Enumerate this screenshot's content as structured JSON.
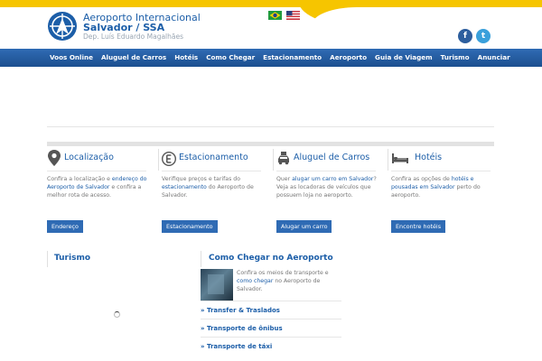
{
  "header": {
    "title_line1": "Aeroporto Internacional",
    "title_line2": "Salvador / SSA",
    "subtitle": "Dep. Luís Eduardo Magalhães",
    "colors": {
      "brand": "#1c5ea8",
      "accent": "#f6c500"
    }
  },
  "social": {
    "facebook": "f",
    "twitter": "t"
  },
  "nav": {
    "items": [
      "Voos Online",
      "Aluguel de Carros",
      "Hotéis",
      "Como Chegar",
      "Estacionamento",
      "Aeroporto",
      "Guia de Viagem",
      "Turismo",
      "Anunciar"
    ]
  },
  "cards": [
    {
      "icon": "map-pin-icon",
      "title": "Localização",
      "text_a": "Confira a localização e ",
      "link": "endereço do Aeroporto de Salvador",
      "text_b": " e confira a melhor rota de acesso.",
      "button": "Endereço"
    },
    {
      "icon": "parking-icon",
      "title": "Estacionamento",
      "text_a": "Verifique preços e tarifas do ",
      "link": "estacionamento",
      "text_b": " do Aeroporto de Salvador.",
      "button": "Estacionamento"
    },
    {
      "icon": "car-icon",
      "title": "Aluguel de Carros",
      "text_a": "Quer ",
      "link": "alugar um carro em Salvador",
      "text_b": "? Veja as locadoras de veículos que possuem loja no aeroporto.",
      "button": "Alugar um carro"
    },
    {
      "icon": "bed-icon",
      "title": "Hotéis",
      "text_a": "Confira as opções de ",
      "link": "hotéis e pousadas em Salvador",
      "text_b": " perto do aeroporto.",
      "button": "Encontre hotéis"
    }
  ],
  "turismo": {
    "title": "Turismo"
  },
  "chegar": {
    "title": "Como Chegar no Aeroporto",
    "text_a": "Confira os meios de transporte e ",
    "link": "como chegar",
    "text_b": " no Aeroporto de Salvador.",
    "items": [
      "» Transfer & Traslados",
      "» Transporte de ônibus",
      "» Transporte de táxi"
    ]
  }
}
